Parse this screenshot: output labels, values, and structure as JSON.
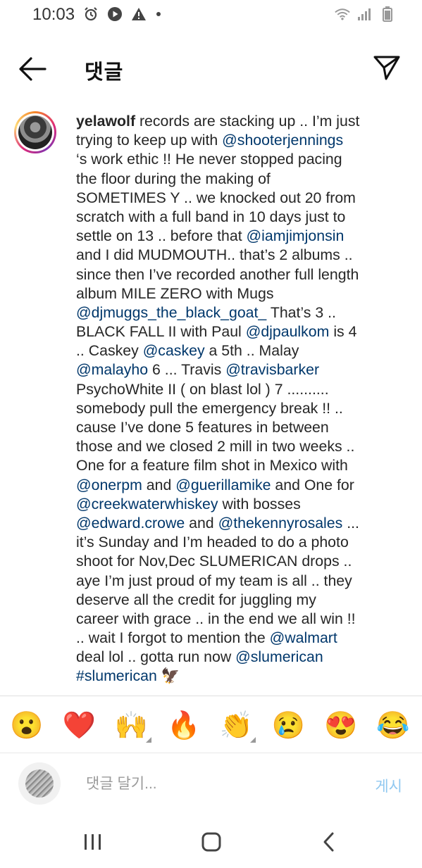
{
  "status_bar": {
    "time": "10:03",
    "left_icons": [
      "alarm-icon",
      "play-icon",
      "warning-icon",
      "dot-icon"
    ],
    "right_icons": [
      "wifi-icon",
      "signal-icon",
      "battery-icon"
    ]
  },
  "header": {
    "title": "댓글",
    "back_icon": "arrow-left-icon",
    "send_icon": "paper-plane-icon"
  },
  "comment": {
    "username": "yelawolf",
    "lines": [
      [
        {
          "t": "text",
          "v": " records are stacking up .. I’m just"
        }
      ],
      [
        {
          "t": "text",
          "v": "trying to keep up with  "
        },
        {
          "t": "mention",
          "v": "@shooterjennings"
        }
      ],
      [
        {
          "t": "text",
          "v": "‘s work ethic !! He never stopped pacing"
        }
      ],
      [
        {
          "t": "text",
          "v": "the floor during the making of"
        }
      ],
      [
        {
          "t": "text",
          "v": "SOMETIMES Y .. we knocked out 20 from"
        }
      ],
      [
        {
          "t": "text",
          "v": "scratch with a full band in 10 days just to"
        }
      ],
      [
        {
          "t": "text",
          "v": "settle on 13 .. before that "
        },
        {
          "t": "mention",
          "v": "@iamjimjonsin"
        }
      ],
      [
        {
          "t": "text",
          "v": "and I did MUDMOUTH.. that’s 2 albums .."
        }
      ],
      [
        {
          "t": "text",
          "v": "since then I’ve recorded another full length"
        }
      ],
      [
        {
          "t": "text",
          "v": "album MILE ZERO with Mugs"
        }
      ],
      [
        {
          "t": "mention",
          "v": "@djmuggs_the_black_goat_"
        },
        {
          "t": "text",
          "v": "  That’s 3 .."
        }
      ],
      [
        {
          "t": "text",
          "v": "BLACK FALL II with Paul "
        },
        {
          "t": "mention",
          "v": "@djpaulkom"
        },
        {
          "t": "text",
          "v": " is 4"
        }
      ],
      [
        {
          "t": "text",
          "v": ".. Caskey "
        },
        {
          "t": "mention",
          "v": "@caskey"
        },
        {
          "t": "text",
          "v": " a 5th .. Malay"
        }
      ],
      [
        {
          "t": "mention",
          "v": "@malayho"
        },
        {
          "t": "text",
          "v": " 6 ... Travis "
        },
        {
          "t": "mention",
          "v": "@travisbarker"
        }
      ],
      [
        {
          "t": "text",
          "v": "PsychoWhite II ( on blast lol ) 7 .........."
        }
      ],
      [
        {
          "t": "text",
          "v": "somebody pull the emergency break !! .."
        }
      ],
      [
        {
          "t": "text",
          "v": "cause I’ve done 5 features in between"
        }
      ],
      [
        {
          "t": "text",
          "v": "those and we closed 2 mill in two weeks .."
        }
      ],
      [
        {
          "t": "text",
          "v": "One for a feature film shot in Mexico with"
        }
      ],
      [
        {
          "t": "mention",
          "v": "@onerpm"
        },
        {
          "t": "text",
          "v": " and "
        },
        {
          "t": "mention",
          "v": "@guerillamike"
        },
        {
          "t": "text",
          "v": " and One for"
        }
      ],
      [
        {
          "t": "mention",
          "v": "@creekwaterwhiskey"
        },
        {
          "t": "text",
          "v": " with bosses"
        }
      ],
      [
        {
          "t": "mention",
          "v": "@edward.crowe"
        },
        {
          "t": "text",
          "v": " and "
        },
        {
          "t": "mention",
          "v": "@thekennyrosales"
        },
        {
          "t": "text",
          "v": " ..."
        }
      ],
      [
        {
          "t": "text",
          "v": "it’s Sunday and I’m headed to do a photo"
        }
      ],
      [
        {
          "t": "text",
          "v": "shoot for Nov,Dec SLUMERICAN drops .."
        }
      ],
      [
        {
          "t": "text",
          "v": "aye I’m just proud of my team is all .. they"
        }
      ],
      [
        {
          "t": "text",
          "v": "deserve all the credit for juggling my"
        }
      ],
      [
        {
          "t": "text",
          "v": "career with grace .. in the end we all win !!"
        }
      ],
      [
        {
          "t": "text",
          "v": ".. wait I forgot to mention the "
        },
        {
          "t": "mention",
          "v": "@walmart"
        }
      ],
      [
        {
          "t": "text",
          "v": "deal lol .. gotta run now "
        },
        {
          "t": "mention",
          "v": "@slumerican"
        }
      ],
      [
        {
          "t": "mention",
          "v": "#slumerican"
        },
        {
          "t": "text",
          "v": " 🦅"
        }
      ]
    ]
  },
  "emoji_bar": {
    "emojis": [
      {
        "char": "😮",
        "name": "surprised-emoji",
        "variants": false
      },
      {
        "char": "❤️",
        "name": "heart-emoji",
        "variants": false
      },
      {
        "char": "🙌",
        "name": "raised-hands-emoji",
        "variants": true
      },
      {
        "char": "🔥",
        "name": "fire-emoji",
        "variants": false
      },
      {
        "char": "👏",
        "name": "clapping-hands-emoji",
        "variants": true
      },
      {
        "char": "😢",
        "name": "crying-emoji",
        "variants": false
      },
      {
        "char": "😍",
        "name": "heart-eyes-emoji",
        "variants": false
      },
      {
        "char": "😂",
        "name": "tears-of-joy-emoji",
        "variants": false
      }
    ]
  },
  "comment_input": {
    "placeholder": "댓글 달기...",
    "value": "",
    "post_label": "게시"
  },
  "nav_bar": {
    "icons": [
      "recent-apps-icon",
      "home-icon",
      "back-icon"
    ]
  },
  "colors": {
    "mention": "#00376b",
    "post_disabled": "#90c8f0",
    "text": "#262626"
  }
}
